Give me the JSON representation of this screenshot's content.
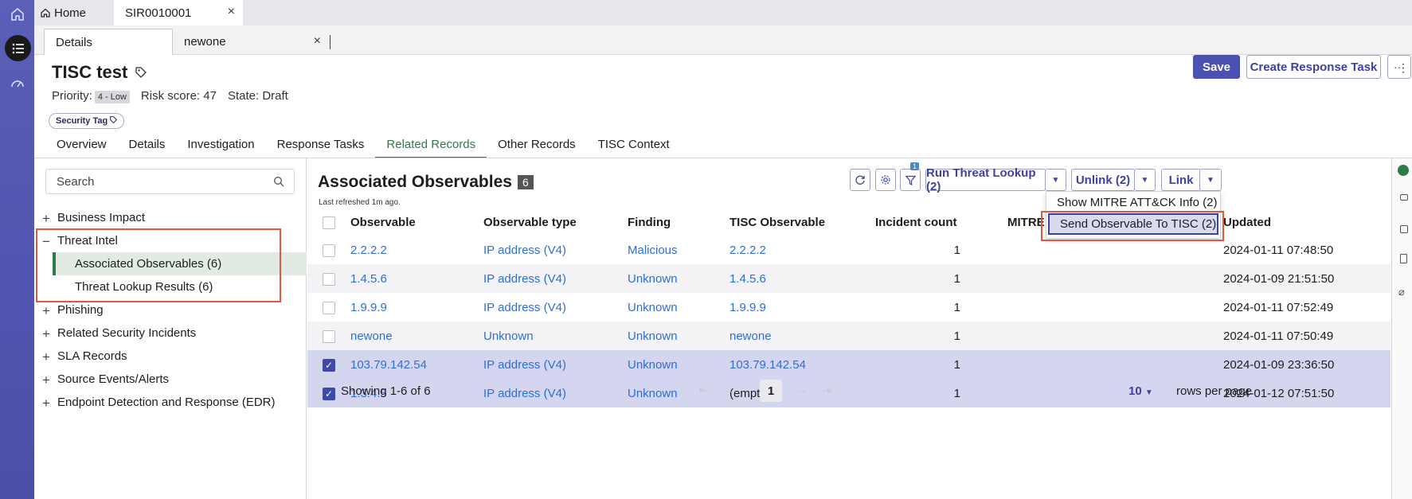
{
  "tabs": {
    "home": "Home",
    "sir": "SIR0010001",
    "details": "Details",
    "newone": "newone"
  },
  "record": {
    "title": "TISC test",
    "priority_label": "Priority:",
    "priority_value": "4 - Low",
    "risk_label": "Risk score:",
    "risk_value": "47",
    "state_label": "State:",
    "state_value": "Draft",
    "tag": "Security Tag"
  },
  "actions": {
    "save": "Save",
    "create": "Create Response Task",
    "more": "···"
  },
  "record_tabs": [
    "Overview",
    "Details",
    "Investigation",
    "Response Tasks",
    "Related Records",
    "Other Records",
    "TISC Context"
  ],
  "sidebar": {
    "search_placeholder": "Search",
    "items": [
      {
        "label": "Business Impact"
      },
      {
        "label": "Threat Intel"
      },
      {
        "label": "Associated Observables (6)"
      },
      {
        "label": "Threat Lookup Results (6)"
      },
      {
        "label": "Phishing"
      },
      {
        "label": "Related Security Incidents"
      },
      {
        "label": "SLA Records"
      },
      {
        "label": "Source Events/Alerts"
      },
      {
        "label": "Endpoint Detection and Response (EDR)"
      }
    ]
  },
  "main": {
    "title": "Associated Observables",
    "count": "6",
    "refreshed": "Last refreshed 1m ago.",
    "filter_badge": "1",
    "run_lookup": "Run Threat Lookup (2)",
    "unlink": "Unlink (2)",
    "link": "Link",
    "dropdown": [
      "Show MITRE ATT&CK Info (2)",
      "Send Observable To TISC (2)"
    ],
    "columns": [
      "Observable",
      "Observable type",
      "Finding",
      "TISC Observable",
      "Incident count",
      "MITRE ATT&CK Information",
      "Updated"
    ],
    "rows": [
      {
        "obs": "2.2.2.2",
        "type": "IP address (V4)",
        "finding": "Malicious",
        "tisc": "2.2.2.2",
        "count": "1",
        "updated": "2024-01-11 07:48:50"
      },
      {
        "obs": "1.4.5.6",
        "type": "IP address (V4)",
        "finding": "Unknown",
        "tisc": "1.4.5.6",
        "count": "1",
        "updated": "2024-01-09 21:51:50"
      },
      {
        "obs": "1.9.9.9",
        "type": "IP address (V4)",
        "finding": "Unknown",
        "tisc": "1.9.9.9",
        "count": "1",
        "updated": "2024-01-11 07:52:49"
      },
      {
        "obs": "newone",
        "type": "Unknown",
        "finding": "Unknown",
        "tisc": "newone",
        "count": "1",
        "updated": "2024-01-11 07:50:49"
      },
      {
        "obs": "103.79.142.54",
        "type": "IP address (V4)",
        "finding": "Unknown",
        "tisc": "103.79.142.54",
        "count": "1",
        "updated": "2024-01-09 23:36:50"
      },
      {
        "obs": "1.3.4.5",
        "type": "IP address (V4)",
        "finding": "Unknown",
        "tisc": "(empty)",
        "count": "1",
        "updated": "2024-01-12 07:51:50"
      }
    ],
    "showing": "Showing 1-6 of 6",
    "page": "1",
    "rows_per_page_value": "10",
    "rows_per_page_label": "rows per page"
  }
}
